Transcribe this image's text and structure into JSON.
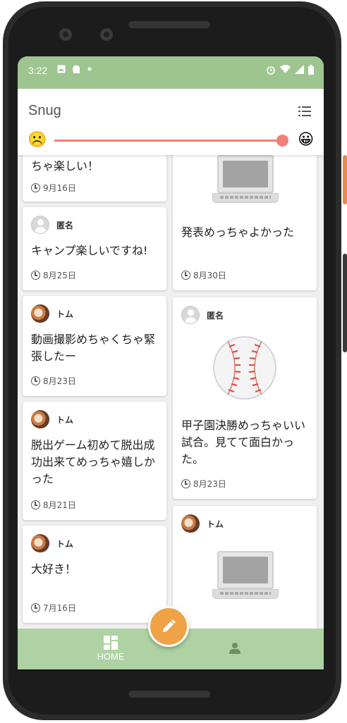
{
  "statusbar": {
    "time": "3:22",
    "left_icons": [
      "image-icon",
      "evernote-icon",
      "dot-icon"
    ],
    "right_icons": [
      "alarm-icon",
      "wifi-icon",
      "signal-icon",
      "battery-icon"
    ]
  },
  "appbar": {
    "title": "Snug",
    "menu_icon": "list-icon"
  },
  "mood_slider": {
    "min_icon": "☹️",
    "max_icon": "😀",
    "value": 0.98,
    "color": "#ee8078"
  },
  "feed": {
    "left": [
      {
        "text": "ちゃ楽しい！",
        "date": "9月16日"
      },
      {
        "author": "匿名",
        "avatar": "anonymous",
        "text": "キャンプ楽しいですね!",
        "date": "8月25日"
      },
      {
        "author": "トム",
        "avatar": "photo",
        "text": "動画撮影めちゃくちゃ緊張したー",
        "date": "8月23日"
      },
      {
        "author": "トム",
        "avatar": "photo",
        "text": "脱出ゲーム初めて脱出成功出来てめっちゃ嬉しかった",
        "date": "8月21日"
      },
      {
        "author": "トム",
        "avatar": "photo",
        "text": "大好き！",
        "date": "7月16日"
      }
    ],
    "right": [
      {
        "image": "laptop",
        "text": "発表めっちゃよかった",
        "date": "8月30日"
      },
      {
        "author": "匿名",
        "avatar": "anonymous",
        "image": "baseball",
        "text": "甲子園決勝めっちゃいい試合。見てて面白かった。",
        "date": "8月23日"
      },
      {
        "author": "トム",
        "avatar": "photo",
        "image": "laptop"
      }
    ]
  },
  "fab": {
    "icon": "pencil-icon",
    "color": "#f0a247"
  },
  "bottom_nav": {
    "home_label": "HOME",
    "home_icon": "dashboard-icon",
    "profile_icon": "person-icon",
    "background": "#aed2a4"
  },
  "colors": {
    "statusbar": "#9ec590",
    "accent": "#ee8078"
  }
}
